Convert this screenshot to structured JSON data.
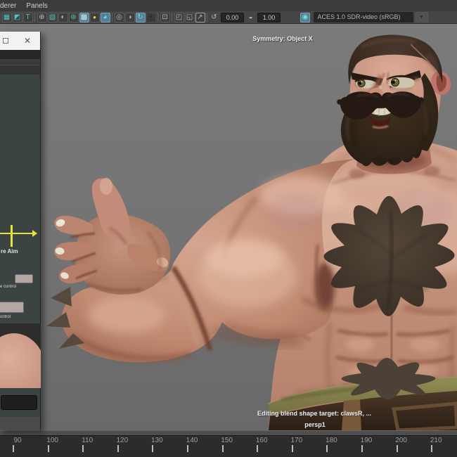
{
  "window": {
    "menu_items": [
      "derer",
      "Panels"
    ]
  },
  "toolbar": {
    "items": [
      {
        "type": "icon",
        "glyph": "▦",
        "tone": "teal",
        "name": "grid-layout-icon"
      },
      {
        "type": "icon",
        "glyph": "◩",
        "tone": "teal",
        "name": "image-plane-icon"
      },
      {
        "type": "icon",
        "glyph": "T",
        "tone": "teal",
        "name": "text-hud-icon"
      },
      {
        "type": "sep"
      },
      {
        "type": "icon",
        "glyph": "⊕",
        "tone": "gray",
        "name": "wireframe-icon"
      },
      {
        "type": "icon",
        "glyph": "▧",
        "tone": "teal",
        "name": "shaded-icon"
      },
      {
        "type": "icon",
        "glyph": "◐",
        "tone": "gray",
        "name": "flat-shaded-icon"
      },
      {
        "type": "icon",
        "glyph": "⊛",
        "tone": "teal",
        "name": "wireframe-on-shaded-icon"
      },
      {
        "type": "icon",
        "glyph": "▩",
        "tone": "gray",
        "active": true,
        "name": "textured-icon"
      },
      {
        "type": "icon",
        "glyph": "●",
        "tone": "yellow",
        "name": "lights-icon"
      },
      {
        "type": "icon",
        "glyph": "◕",
        "tone": "teal",
        "active": true,
        "name": "shadows-icon"
      },
      {
        "type": "sep"
      },
      {
        "type": "icon",
        "glyph": "◎",
        "tone": "gray",
        "name": "ambient-occlusion-icon"
      },
      {
        "type": "icon",
        "glyph": "◑",
        "tone": "gray",
        "name": "motion-blur-icon"
      },
      {
        "type": "icon",
        "glyph": "↻",
        "tone": "teal",
        "active": true,
        "name": "multisample-icon"
      },
      {
        "type": "icon",
        "glyph": "▪",
        "tone": "dark",
        "name": "texture-placement-icon"
      },
      {
        "type": "sep"
      },
      {
        "type": "icon",
        "glyph": "⊡",
        "tone": "gray",
        "name": "select-object-icon"
      },
      {
        "type": "sep"
      },
      {
        "type": "icon",
        "glyph": "◰",
        "tone": "gray",
        "name": "snapshot-icon"
      },
      {
        "type": "icon",
        "glyph": "◱",
        "tone": "gray",
        "name": "duplicate-view-icon"
      },
      {
        "type": "icon",
        "glyph": "↗",
        "tone": "gray",
        "boxed": true,
        "name": "isolate-select-icon"
      },
      {
        "type": "sep"
      },
      {
        "type": "icon",
        "glyph": "↺",
        "tone": "gray",
        "bare": true,
        "name": "exposure-reset-icon"
      },
      {
        "type": "field",
        "value": "0.00",
        "name": "exposure-field"
      },
      {
        "type": "icon",
        "glyph": "◒",
        "tone": "gray",
        "bare": true,
        "name": "gamma-icon"
      },
      {
        "type": "field",
        "value": "1.00",
        "name": "gamma-field"
      },
      {
        "type": "icon",
        "glyph": "◉",
        "tone": "teal",
        "active": true,
        "ml": 26,
        "name": "colorspace-icon"
      },
      {
        "type": "select",
        "value": "ACES 1.0 SDR-video (sRGB)",
        "name": "colorspace-select"
      },
      {
        "type": "arrow",
        "glyph": "▼",
        "name": "colorspace-menu-arrow"
      }
    ]
  },
  "panel": {
    "close_label": "✕",
    "aim_label": "re Aim",
    "control1_label": "e control",
    "control2_label": "ontrol",
    "swatch_color": "#b3a6a3",
    "slider_color": "#e8e337"
  },
  "viewport": {
    "symmetry_text": "Symmetry: Object X",
    "editing_text": "Editing blend shape target: clawsR, ...",
    "camera_label": "persp1"
  },
  "timeline": {
    "start": 90,
    "end": 210,
    "step": 10,
    "tick_start_x": 18,
    "tick_spacing": 49.6
  },
  "scene": {
    "subject": "sculpted muscular male character with beard",
    "colors": {
      "hair": "#3a2a21",
      "beard": "#30241c",
      "mustache": "#241a13",
      "chest_hair": "#4a3c31",
      "navel_hair": "#4c4136",
      "skin": "#cb9a89",
      "pants": "#7c7843",
      "belt": "#38291d",
      "strap": "#77593a",
      "spikes": "#564a3f"
    }
  }
}
